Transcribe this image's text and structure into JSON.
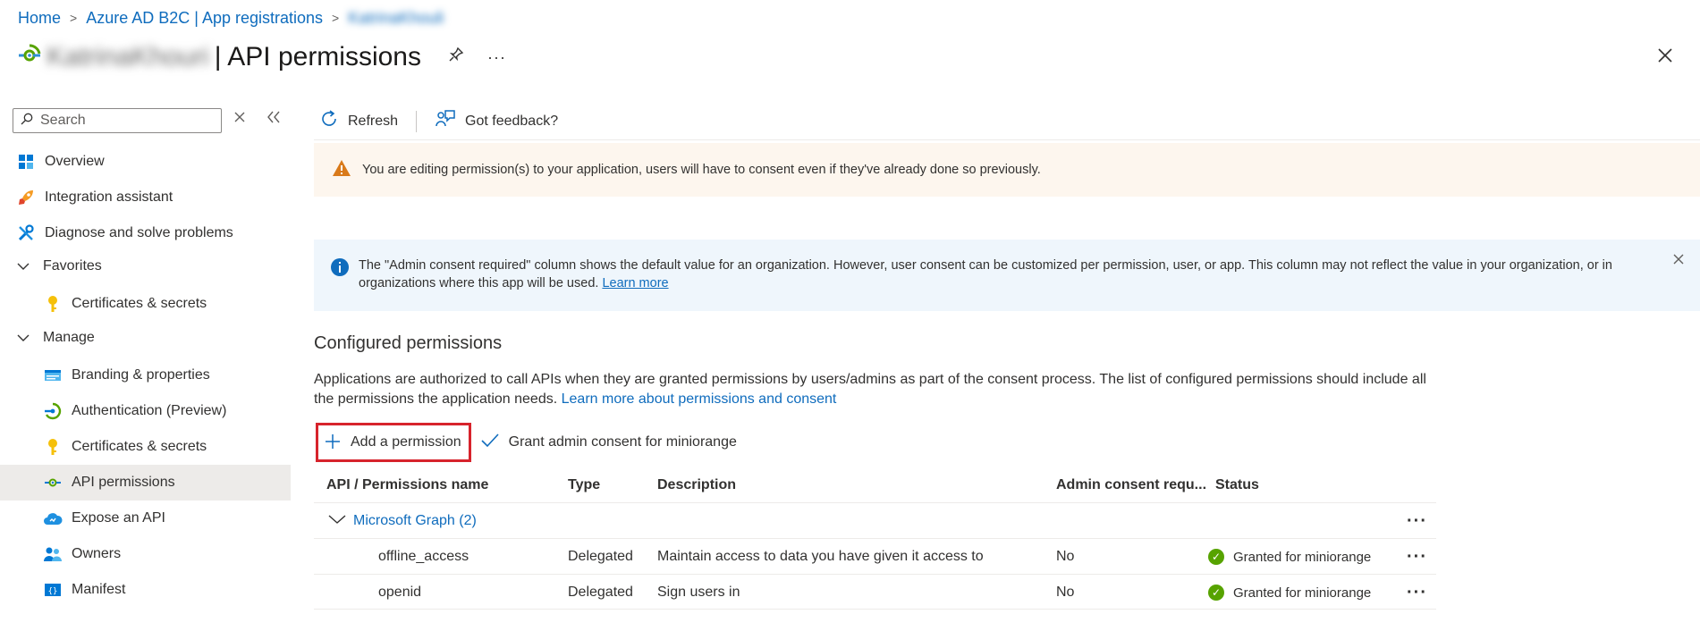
{
  "breadcrumb": {
    "items": [
      "Home",
      "Azure AD B2C | App registrations",
      "KatrinaKhouli"
    ]
  },
  "header": {
    "app_name": "KatrinaKhouri",
    "title": "| API permissions",
    "pin_icon": "pin-icon",
    "more_icon": "more-icon",
    "close_icon": "close-icon"
  },
  "sidebar": {
    "search_placeholder": "Search",
    "items": [
      {
        "label": "Overview",
        "icon": "grid-icon"
      },
      {
        "label": "Integration assistant",
        "icon": "rocket-icon"
      },
      {
        "label": "Diagnose and solve problems",
        "icon": "wrench-icon"
      },
      {
        "label": "Favorites",
        "icon": "chevron-down-icon"
      },
      {
        "label": "Certificates & secrets",
        "icon": "key-icon"
      },
      {
        "label": "Manage",
        "icon": "chevron-down-icon"
      },
      {
        "label": "Branding & properties",
        "icon": "branding-icon"
      },
      {
        "label": "Authentication (Preview)",
        "icon": "auth-icon"
      },
      {
        "label": "Certificates & secrets",
        "icon": "key-icon"
      },
      {
        "label": "API permissions",
        "icon": "api-icon"
      },
      {
        "label": "Expose an API",
        "icon": "cloud-icon"
      },
      {
        "label": "Owners",
        "icon": "people-icon"
      },
      {
        "label": "Manifest",
        "icon": "manifest-icon"
      }
    ]
  },
  "toolbar": {
    "refresh_label": "Refresh",
    "feedback_label": "Got feedback?"
  },
  "warning": {
    "text": "You are editing permission(s) to your application, users will have to consent even if they've already done so previously."
  },
  "info": {
    "text": "The \"Admin consent required\" column shows the default value for an organization. However, user consent can be customized per permission, user, or app. This column may not reflect the value in your organization, or in organizations where this app will be used.",
    "link": "Learn more"
  },
  "configured": {
    "title": "Configured permissions",
    "description": "Applications are authorized to call APIs when they are granted permissions by users/admins as part of the consent process. The list of configured permissions should include all the permissions the application needs.",
    "link": "Learn more about permissions and consent",
    "add_label": "Add a permission",
    "grant_label": "Grant admin consent for miniorange"
  },
  "table": {
    "headers": [
      "API / Permissions name",
      "Type",
      "Description",
      "Admin consent requ...",
      "Status"
    ],
    "group": "Microsoft Graph (2)",
    "rows": [
      {
        "name": "offline_access",
        "type": "Delegated",
        "description": "Maintain access to data you have given it access to",
        "admin": "No",
        "status": "Granted for miniorange"
      },
      {
        "name": "openid",
        "type": "Delegated",
        "description": "Sign users in",
        "admin": "No",
        "status": "Granted for miniorange"
      }
    ]
  },
  "colors": {
    "link": "#0f6cbd",
    "warning_bg": "#fdf6ee",
    "info_bg": "#eff6fc",
    "highlight_border": "#d7232c",
    "granted": "#57a300",
    "active_nav_bg": "#edebe9"
  }
}
